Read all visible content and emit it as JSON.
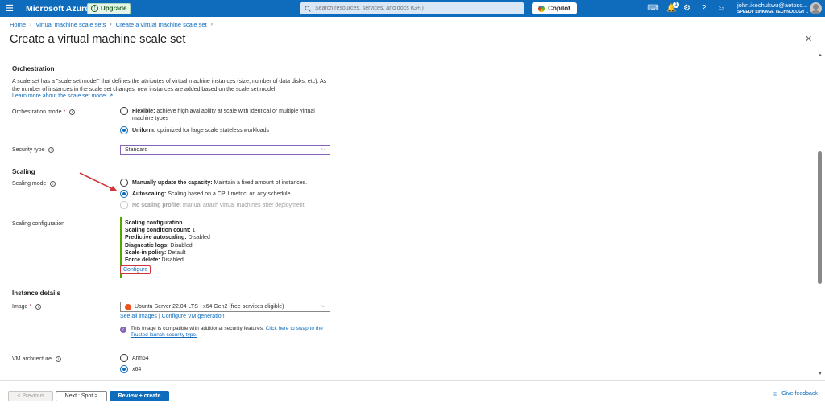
{
  "topbar": {
    "menu_icon": "hamburger-icon",
    "brand": "Microsoft Azure",
    "upgrade_label": "Upgrade",
    "search_placeholder": "Search resources, services, and docs (G+/)",
    "copilot_label": "Copilot",
    "notification_count": "1",
    "account_email": "john.ikechukwu@aetosc...",
    "account_org": "SPEEDY LINKAGE TECHNOLOGY ..."
  },
  "breadcrumb": {
    "items": [
      "Home",
      "Virtual machine scale sets",
      "Create a virtual machine scale set"
    ]
  },
  "page": {
    "title": "Create a virtual machine scale set",
    "more": "···",
    "close": "✕"
  },
  "orchestration": {
    "title": "Orchestration",
    "description": "A scale set has a \"scale set model\" that defines the attributes of virtual machine instances (size, number of data disks, etc). As the number of instances in the scale set changes, new instances are added based on the scale set model.",
    "learn_more": "Learn more about the scale set model",
    "mode_label": "Orchestration mode",
    "flexible_title": "Flexible:",
    "flexible_desc": "achieve high availability at scale with identical or multiple virtual machine types",
    "uniform_title": "Uniform:",
    "uniform_desc": "optimized for large scale stateless workloads",
    "selected": "Uniform"
  },
  "security": {
    "label": "Security type",
    "value": "Standard"
  },
  "scaling": {
    "title": "Scaling",
    "mode_label": "Scaling mode",
    "manual_title": "Manually update the capacity:",
    "manual_desc": "Maintain a fixed amount of instances.",
    "auto_title": "Autoscaling:",
    "auto_desc": "Scaling based on a CPU metric, on any schedule.",
    "none_title": "No scaling profile:",
    "none_desc": "manual attach virtual machines after deployment",
    "selected": "Autoscaling",
    "config_label": "Scaling configuration",
    "config": {
      "heading": "Scaling configuration",
      "condition_key": "Scaling condition count:",
      "condition_val": "1",
      "predictive_key": "Predictive autoscaling:",
      "predictive_val": "Disabled",
      "diag_key": "Diagnostic logs:",
      "diag_val": "Disabled",
      "scalein_key": "Scale-in policy:",
      "scalein_val": "Default",
      "force_key": "Force delete:",
      "force_val": "Disabled",
      "configure_link": "Configure"
    }
  },
  "instance": {
    "title": "Instance details",
    "image_label": "Image",
    "image_value": "Ubuntu Server 22.04 LTS - x64 Gen2 (free services eligible)",
    "see_all": "See all images",
    "divider": "|",
    "configure_gen": "Configure VM generation",
    "note_text": "This image is compatible with additional security features.",
    "note_link": "Click here to swap to the Trusted launch security type.",
    "arch_label": "VM architecture",
    "arm64": "Arm64",
    "x64": "x64",
    "arch_selected": "x64"
  },
  "footer": {
    "previous": "< Previous",
    "next": "Next : Spot >",
    "review": "Review + create",
    "feedback": "Give feedback"
  },
  "colors": {
    "azure_blue": "#0f6cbd",
    "annotation_red": "#d13438",
    "config_border": "#57a300"
  }
}
